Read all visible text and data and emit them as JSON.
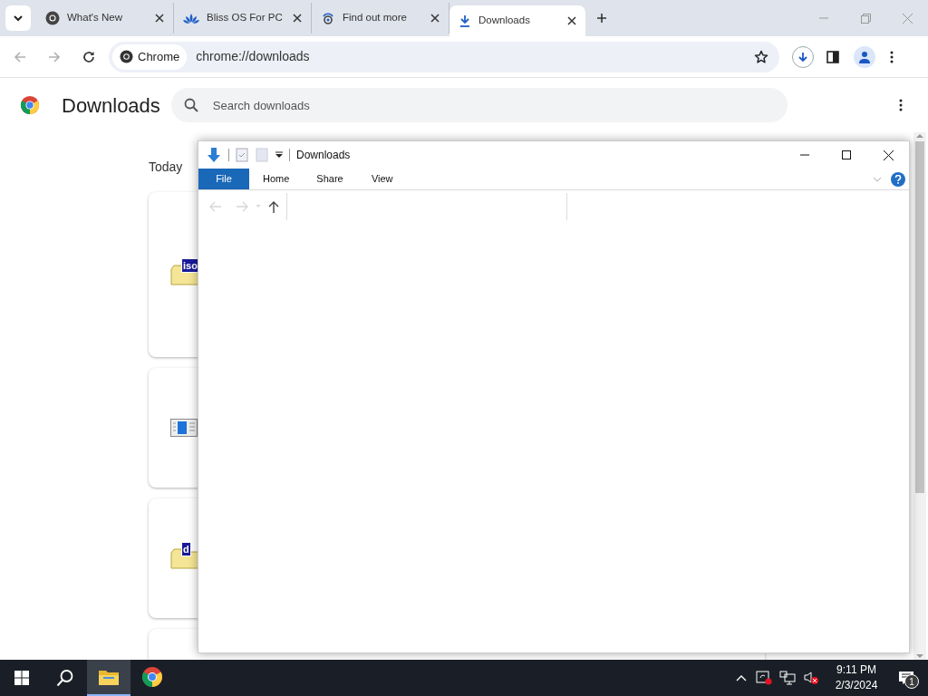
{
  "tabs": [
    {
      "title": "What's New",
      "kind": "chrome",
      "selected": false
    },
    {
      "title": "Bliss OS For PC",
      "kind": "lotus",
      "selected": false
    },
    {
      "title": "Find out more",
      "kind": "swirl",
      "selected": false
    },
    {
      "title": "Downloads",
      "kind": "download",
      "selected": true
    }
  ],
  "omnibox": {
    "chip": "Chrome",
    "url": "chrome://downloads"
  },
  "page": {
    "title": "Downloads",
    "search": {
      "placeholder": "Search downloads"
    },
    "section": "Today",
    "cards": [
      {
        "kind": "folder",
        "label": "iso"
      },
      {
        "kind": "document"
      },
      {
        "kind": "folder",
        "label": "d"
      },
      {
        "kind": "blank"
      }
    ]
  },
  "explorer": {
    "title": "Downloads",
    "ribbon_tabs": [
      {
        "label": "File",
        "selected": true
      },
      {
        "label": "Home",
        "selected": false
      },
      {
        "label": "Share",
        "selected": false
      },
      {
        "label": "View",
        "selected": false
      }
    ]
  },
  "taskbar": {
    "apps": [
      {
        "kind": "explorer",
        "active": true
      },
      {
        "kind": "chrome",
        "active": false
      }
    ],
    "time": "9:11 PM",
    "date": "2/3/2024",
    "notifications": "1"
  }
}
